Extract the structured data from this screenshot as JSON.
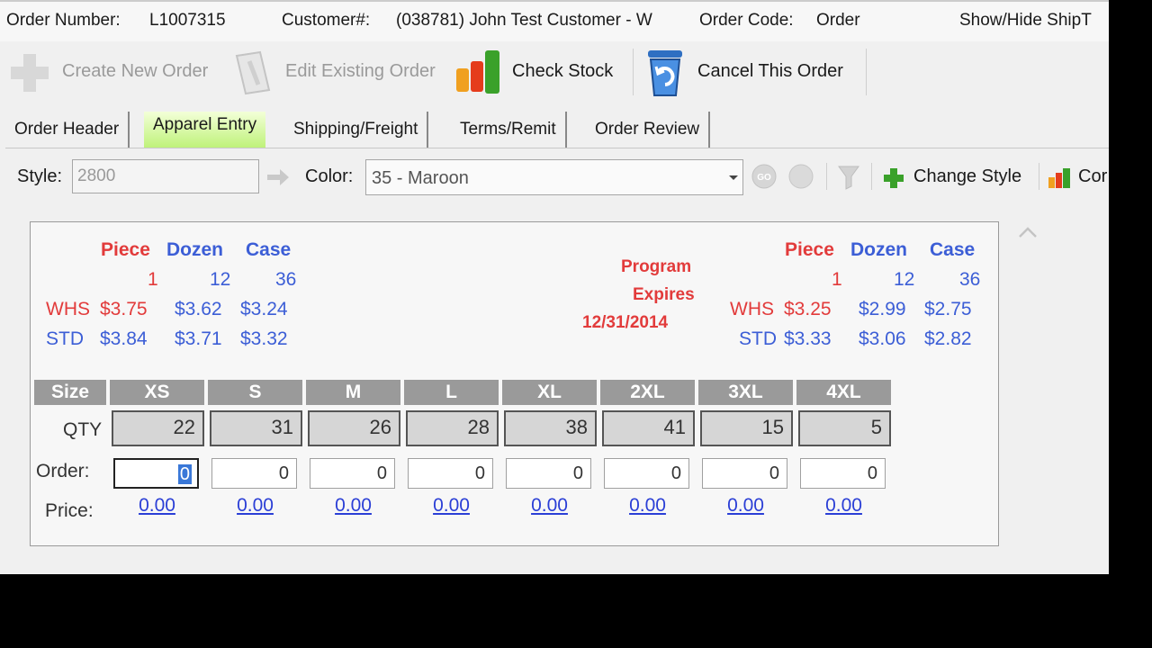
{
  "header": {
    "order_number_label": "Order Number:",
    "order_number": "L1007315",
    "customer_label": "Customer#:",
    "customer": "(038781) John Test Customer - W",
    "order_code_label": "Order Code:",
    "order_code": "Order",
    "ship_toggle": "Show/Hide ShipT"
  },
  "toolbar": {
    "create": "Create New Order",
    "edit": "Edit Existing Order",
    "check": "Check Stock",
    "cancel": "Cancel This Order"
  },
  "tabs": [
    "Order Header",
    "Apparel Entry",
    "Shipping/Freight",
    "Terms/Remit",
    "Order Review"
  ],
  "active_tab": "Apparel Entry",
  "style_row": {
    "style_label": "Style:",
    "style_value": "2800",
    "color_label": "Color:",
    "color_value": "35 - Maroon",
    "change_style": "Change Style",
    "cut_text": "Cor"
  },
  "pricing": {
    "left": {
      "headers": [
        "Piece",
        "Dozen",
        "Case"
      ],
      "qtys": [
        "1",
        "12",
        "36"
      ],
      "whs_label": "WHS",
      "whs": [
        "$3.75",
        "$3.62",
        "$3.24"
      ],
      "std_label": "STD",
      "std": [
        "$3.84",
        "$3.71",
        "$3.32"
      ]
    },
    "program": [
      "Program",
      "Expires",
      "12/31/2014"
    ],
    "right": {
      "headers": [
        "Piece",
        "Dozen",
        "Case"
      ],
      "qtys": [
        "1",
        "12",
        "36"
      ],
      "whs_label": "WHS",
      "whs": [
        "$3.25",
        "$2.99",
        "$2.75"
      ],
      "std_label": "STD",
      "std": [
        "$3.33",
        "$3.06",
        "$2.82"
      ]
    }
  },
  "grid": {
    "size_label": "Size",
    "qty_label": "QTY",
    "order_label": "Order:",
    "price_label": "Price:",
    "sizes": [
      "XS",
      "S",
      "M",
      "L",
      "XL",
      "2XL",
      "3XL",
      "4XL"
    ],
    "qty": [
      "22",
      "31",
      "26",
      "28",
      "38",
      "41",
      "15",
      "5"
    ],
    "order": [
      "0",
      "0",
      "0",
      "0",
      "0",
      "0",
      "0",
      "0"
    ],
    "price": [
      "0.00",
      "0.00",
      "0.00",
      "0.00",
      "0.00",
      "0.00",
      "0.00",
      "0.00"
    ]
  },
  "colors": {
    "piece": "#e23b3b",
    "dozen_case": "#3c5ed6",
    "active_tab": "#bff27a",
    "link": "#2b3fd6"
  },
  "icons": [
    "plus-icon",
    "edit-document-icon",
    "bar-chart-icon",
    "recycle-bin-icon",
    "arrow-right-icon",
    "go-icon",
    "circle-icon",
    "filter-icon",
    "green-plus-icon",
    "mini-bar-chart-icon",
    "scroll-up-icon"
  ]
}
